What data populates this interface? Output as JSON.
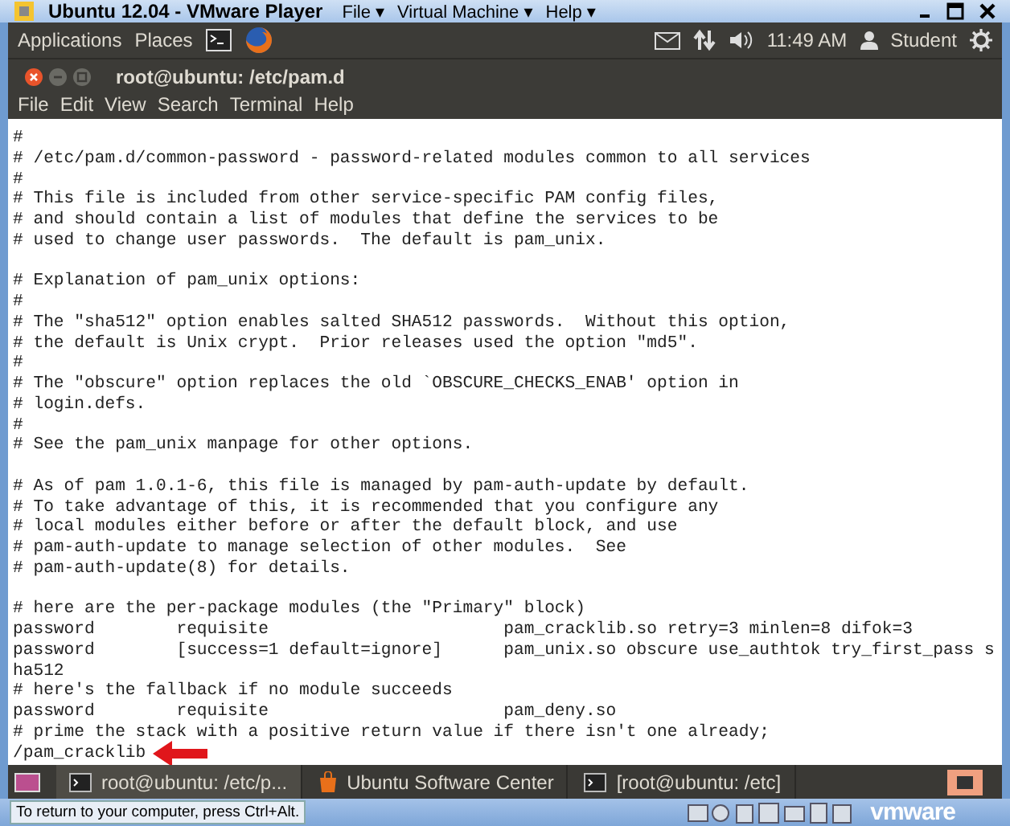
{
  "vmware": {
    "title": "Ubuntu 12.04 - VMware Player",
    "menus": [
      {
        "label": "File",
        "caret": "▾"
      },
      {
        "label": "Virtual Machine",
        "caret": "▾"
      },
      {
        "label": "Help",
        "caret": "▾"
      }
    ]
  },
  "panel": {
    "menus": [
      "Applications",
      "Places"
    ],
    "time": "11:49 AM",
    "user": "Student"
  },
  "terminal": {
    "title": "root@ubuntu: /etc/pam.d",
    "menus": [
      "File",
      "Edit",
      "View",
      "Search",
      "Terminal",
      "Help"
    ],
    "blocks": [
      [
        "#",
        "# /etc/pam.d/common-password - password-related modules common to all services",
        "#",
        "# This file is included from other service-specific PAM config files,",
        "# and should contain a list of modules that define the services to be",
        "# used to change user passwords.  The default is pam_unix."
      ],
      [
        "# Explanation of pam_unix options:",
        "#",
        "# The \"sha512\" option enables salted SHA512 passwords.  Without this option,",
        "# the default is Unix crypt.  Prior releases used the option \"md5\".",
        "#",
        "# The \"obscure\" option replaces the old `OBSCURE_CHECKS_ENAB' option in",
        "# login.defs.",
        "#",
        "# See the pam_unix manpage for other options."
      ],
      [
        "# As of pam 1.0.1-6, this file is managed by pam-auth-update by default.",
        "# To take advantage of this, it is recommended that you configure any",
        "# local modules either before or after the default block, and use",
        "# pam-auth-update to manage selection of other modules.  See",
        "# pam-auth-update(8) for details."
      ],
      [
        "# here are the per-package modules (the \"Primary\" block)",
        "password        requisite                       pam_cracklib.so retry=3 minlen=8 difok=3",
        "password        [success=1 default=ignore]      pam_unix.so obscure use_authtok try_first_pass s",
        "ha512",
        "# here's the fallback if no module succeeds",
        "password        requisite                       pam_deny.so",
        "# prime the stack with a positive return value if there isn't one already;",
        "/pam_cracklib"
      ]
    ]
  },
  "taskbar": {
    "items": [
      {
        "kind": "terminal",
        "label": "root@ubuntu: /etc/p...",
        "selected": true
      },
      {
        "kind": "software",
        "label": "Ubuntu Software Center",
        "selected": false
      },
      {
        "kind": "terminal",
        "label": "[root@ubuntu: /etc]",
        "selected": false
      }
    ]
  },
  "status_bar": {
    "hint": "To return to your computer, press Ctrl+Alt.",
    "brand": "vmware"
  }
}
